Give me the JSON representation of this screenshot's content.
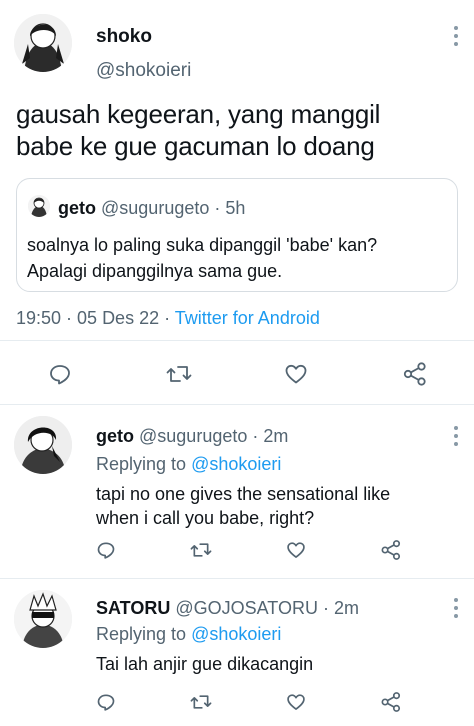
{
  "main_tweet": {
    "display_name": "shoko",
    "handle": "@shokoieri",
    "text_line1": "gausah kegeeran, yang manggil",
    "text_line2": "babe ke gue gacuman lo doang",
    "quoted": {
      "display_name": "geto",
      "handle": "@sugurugeto",
      "time": "· 5h",
      "text_line1": "soalnya lo paling suka dipanggil 'babe' kan?",
      "text_line2": "Apalagi dipanggilnya sama gue."
    },
    "timestamp": "19:50 · 05 Des 22 ·",
    "client": "Twitter for Android"
  },
  "replies": [
    {
      "display_name": "geto",
      "handle": "@sugurugeto",
      "time": "· 2m",
      "replying_label": "Replying to",
      "replying_to": "@shokoieri",
      "text_line1": "tapi no one gives the sensational like",
      "text_line2": "when i call you babe, right?"
    },
    {
      "display_name": "SATORU",
      "handle": "@GOJOSATORU",
      "time": "· 2m",
      "replying_label": "Replying to",
      "replying_to": "@shokoieri",
      "text_line1": "Tai lah anjir gue dikacangin",
      "text_line2": ""
    }
  ],
  "icons": [
    "reply-icon",
    "retweet-icon",
    "like-icon",
    "share-icon",
    "more-icon"
  ],
  "colors": {
    "accent": "#1d9bf0",
    "secondary_text": "#536471",
    "icon": "#536471"
  }
}
